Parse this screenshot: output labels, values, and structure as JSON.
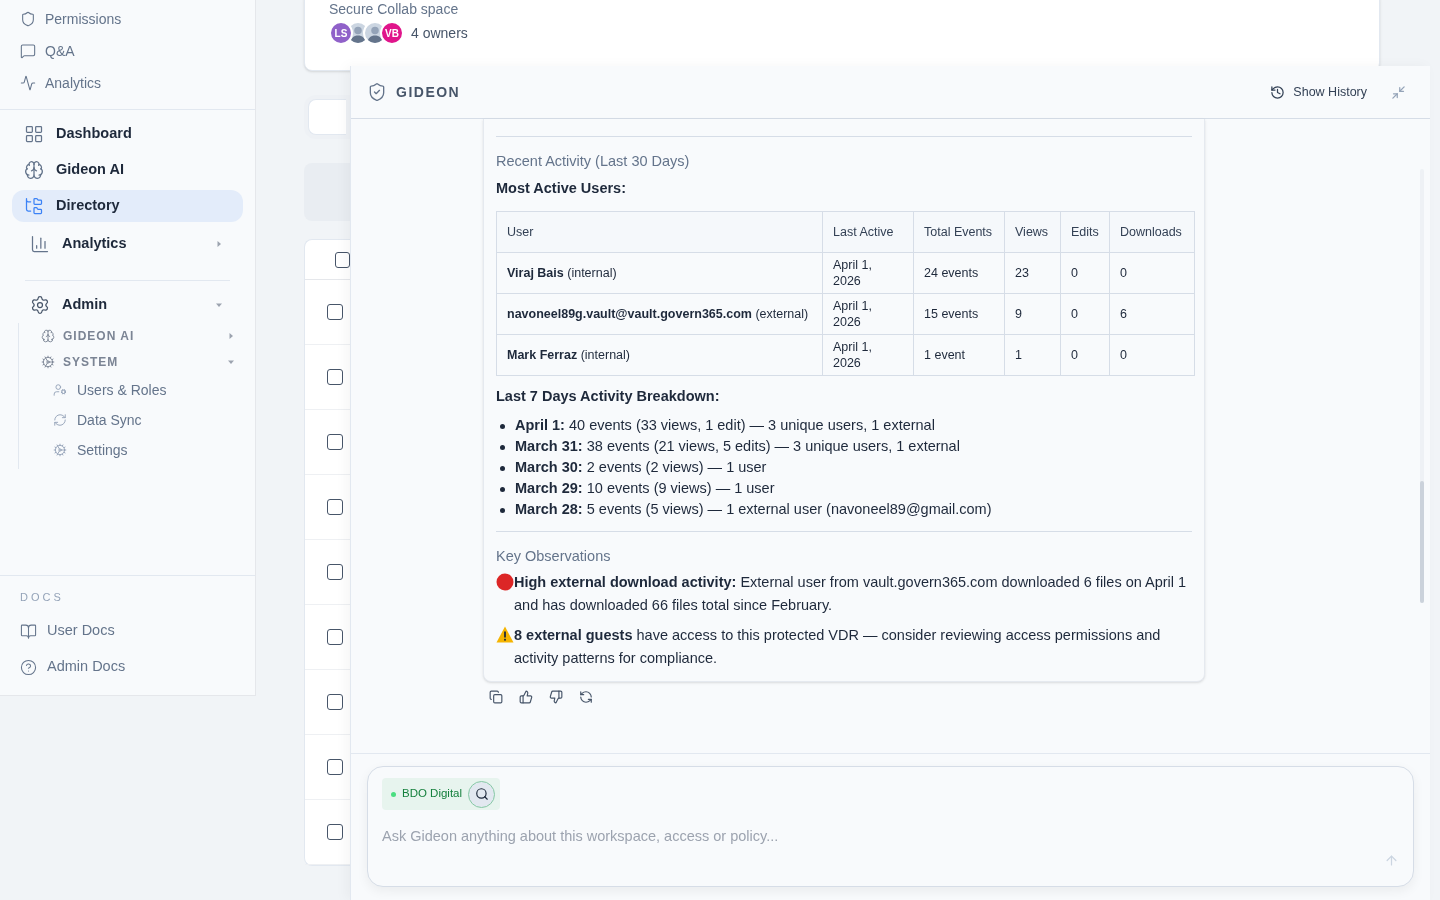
{
  "sidebar": {
    "space_items": [
      {
        "label": "Permissions",
        "selected": false
      },
      {
        "label": "Q&A",
        "selected": false
      },
      {
        "label": "Analytics",
        "selected": false
      }
    ],
    "main_items": [
      {
        "label": "Dashboard",
        "selected": false
      },
      {
        "label": "Gideon AI",
        "selected": false
      },
      {
        "label": "Directory",
        "selected": true
      },
      {
        "label": "Analytics",
        "selected": false,
        "expanded": false
      }
    ],
    "admin": {
      "label": "Admin",
      "expanded": true,
      "groups": [
        {
          "label": "GIDEON AI",
          "expanded": false
        },
        {
          "label": "SYSTEM",
          "expanded": true,
          "children": [
            {
              "label": "Users & Roles"
            },
            {
              "label": "Data Sync"
            },
            {
              "label": "Settings"
            }
          ]
        }
      ]
    },
    "docs": {
      "heading": "DOCS",
      "items": [
        {
          "label": "User Docs"
        },
        {
          "label": "Admin Docs"
        }
      ]
    }
  },
  "space_card": {
    "subtitle": "Secure Collab space",
    "owners": "4 owners",
    "avatars": [
      {
        "kind": "initials",
        "initials": "LS",
        "color": "#9061c9"
      },
      {
        "kind": "photo"
      },
      {
        "kind": "photo"
      },
      {
        "kind": "initials",
        "initials": "VB",
        "color": "#e0158b"
      }
    ]
  },
  "list_table": {
    "header_checked": false,
    "rows": [
      {
        "checked": false
      },
      {
        "checked": false
      },
      {
        "checked": false
      },
      {
        "checked": false
      },
      {
        "checked": false
      },
      {
        "checked": false
      },
      {
        "checked": false
      },
      {
        "checked": false
      },
      {
        "checked": false
      }
    ]
  },
  "chat": {
    "title": "GIDEON",
    "history_button": "Show History",
    "message": {
      "section_title": "Recent Activity (Last 30 Days)",
      "table_title": "Most Active Users:",
      "columns": [
        "User",
        "Last Active",
        "Total Events",
        "Views",
        "Edits",
        "Downloads"
      ],
      "rows": [
        {
          "user": "Viraj Bais",
          "user_type": "(internal)",
          "last_active": "April 1, 2026",
          "total_events": "24 events",
          "views": "23",
          "edits": "0",
          "downloads": "0"
        },
        {
          "user": "navoneel89g.vault@vault.govern365.com",
          "user_type": "(external)",
          "last_active": "April 1, 2026",
          "total_events": "15 events",
          "views": "9",
          "edits": "0",
          "downloads": "6"
        },
        {
          "user": "Mark Ferraz",
          "user_type": "(internal)",
          "last_active": "April 1, 2026",
          "total_events": "1 event",
          "views": "1",
          "edits": "0",
          "downloads": "0"
        }
      ],
      "breakdown_title": "Last 7 Days Activity Breakdown:",
      "breakdown": [
        "**April 1:** 40 events (33 views, 1 edit) — 3 unique users, 1 external",
        "**March 31:** 38 events (21 views, 5 edits) — 3 unique users, 1 external",
        "**March 30:** 2 events (2 views) — 1 user",
        "**March 29:** 10 events (9 views) — 1 user",
        "**March 28:** 5 events (5 views) — 1 external user (navoneel89@gmail.com)"
      ],
      "observations_title": "Key Observations",
      "observations": [
        {
          "kind": "alert",
          "text": "**High external download activity:** External user from vault.govern365.com downloaded 6 files on April 1 and has downloaded 66 files total since February."
        },
        {
          "kind": "warning",
          "text": "**8 external guests** have access to this protected VDR — consider reviewing access permissions and activity patterns for compliance."
        }
      ]
    },
    "input": {
      "chip": "BDO Digital",
      "placeholder": "Ask Gideon anything about this workspace, access or policy..."
    }
  }
}
